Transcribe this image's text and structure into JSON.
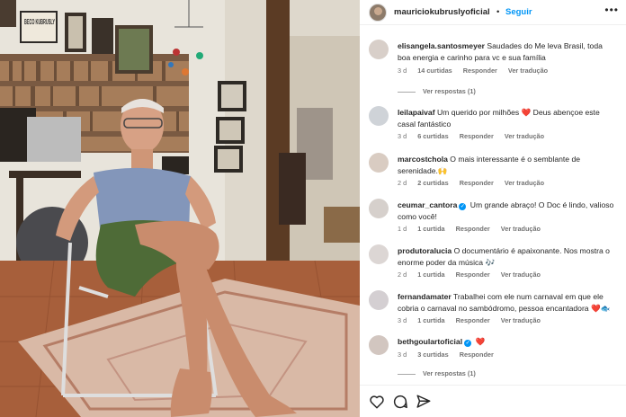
{
  "header": {
    "username": "mauriciokubruslyoficial",
    "separator": "•",
    "follow_label": "Seguir",
    "more_icon": "ellipsis-icon"
  },
  "photo": {
    "sign_text": "BECO KUBRUSLY"
  },
  "comments": [
    {
      "username": "elisangela.santosmeyer",
      "text": "Saudades do Me leva Brasil, toda boa energia e carinho para vc e sua família",
      "time": "3 d",
      "likes": "14 curtidas",
      "reply": "Responder",
      "translate": "Ver tradução",
      "view_replies": "Ver respostas (1)"
    },
    {
      "username": "leilapaivaf",
      "text_before": "Um querido por milhões",
      "emoji": "❤️",
      "text_after": "Deus abençoe este casal fantástico",
      "time": "3 d",
      "likes": "6 curtidas",
      "reply": "Responder",
      "translate": "Ver tradução"
    },
    {
      "username": "marcostchola",
      "text": "O mais interessante é o semblante de serenidade.",
      "emoji": "🙌",
      "time": "2 d",
      "likes": "2 curtidas",
      "reply": "Responder",
      "translate": "Ver tradução"
    },
    {
      "username": "ceumar_cantora",
      "text": "Um grande abraço! O Doc é lindo, valioso como você!",
      "time": "1 d",
      "likes": "1 curtida",
      "reply": "Responder",
      "translate": "Ver tradução"
    },
    {
      "username": "produtoralucia",
      "text_before": "O documentário é apaixonante. Nos mostra o enorme poder da música",
      "emoji": "🎶",
      "time": "2 d",
      "likes": "1 curtida",
      "reply": "Responder",
      "translate": "Ver tradução"
    },
    {
      "username": "fernandamater",
      "text": "Trabalhei com ele num carnaval em que ele cobria o carnaval no sambódromo, pessoa encantadora",
      "emoji": "❤️🐟",
      "time": "3 d",
      "likes": "1 curtida",
      "reply": "Responder",
      "translate": "Ver tradução"
    },
    {
      "username": "bethgoulartoficial",
      "emoji": "❤️",
      "time": "3 d",
      "likes": "3 curtidas",
      "reply": "Responder",
      "view_replies": "Ver respostas (1)"
    }
  ],
  "actions": {
    "like_icon": "heart-outline-icon",
    "comment_icon": "comment-icon",
    "share_icon": "send-icon"
  },
  "colors": {
    "link_blue": "#0095f6",
    "text": "#262626",
    "meta": "#737373",
    "heart_red": "#e0245e"
  }
}
